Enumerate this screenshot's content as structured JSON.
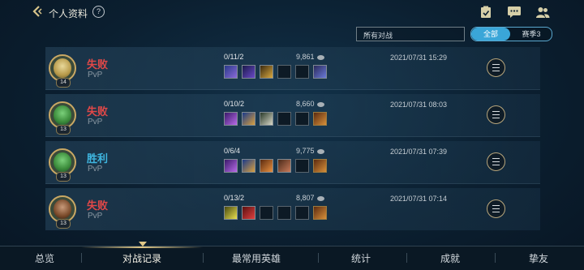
{
  "header": {
    "title": "个人资料",
    "help": "?"
  },
  "filter": {
    "selected": "所有对战",
    "segments": [
      "全部",
      "赛季3"
    ]
  },
  "matches": [
    {
      "result": "失败",
      "outcome": "lose",
      "mode": "PvP",
      "level": "14",
      "kda": "0/11/2",
      "gold": "9,861",
      "datetime": "2021/07/31 15:29"
    },
    {
      "result": "失败",
      "outcome": "lose",
      "mode": "PvP",
      "level": "13",
      "kda": "0/10/2",
      "gold": "8,660",
      "datetime": "2021/07/31 08:03"
    },
    {
      "result": "胜利",
      "outcome": "win",
      "mode": "PvP",
      "level": "13",
      "kda": "0/6/4",
      "gold": "9,775",
      "datetime": "2021/07/31 07:39"
    },
    {
      "result": "失败",
      "outcome": "lose",
      "mode": "PvP",
      "level": "13",
      "kda": "0/13/2",
      "gold": "8,807",
      "datetime": "2021/07/31 07:14"
    }
  ],
  "tabs": [
    "总览",
    "对战记录",
    "最常用英雄",
    "统计",
    "成就",
    "挚友"
  ],
  "active_tab": "对战记录",
  "colors": {
    "lose": "#e04848",
    "win": "#3fb6e0",
    "accent": "#3aa6d8",
    "gold_trim": "#c9a864"
  }
}
